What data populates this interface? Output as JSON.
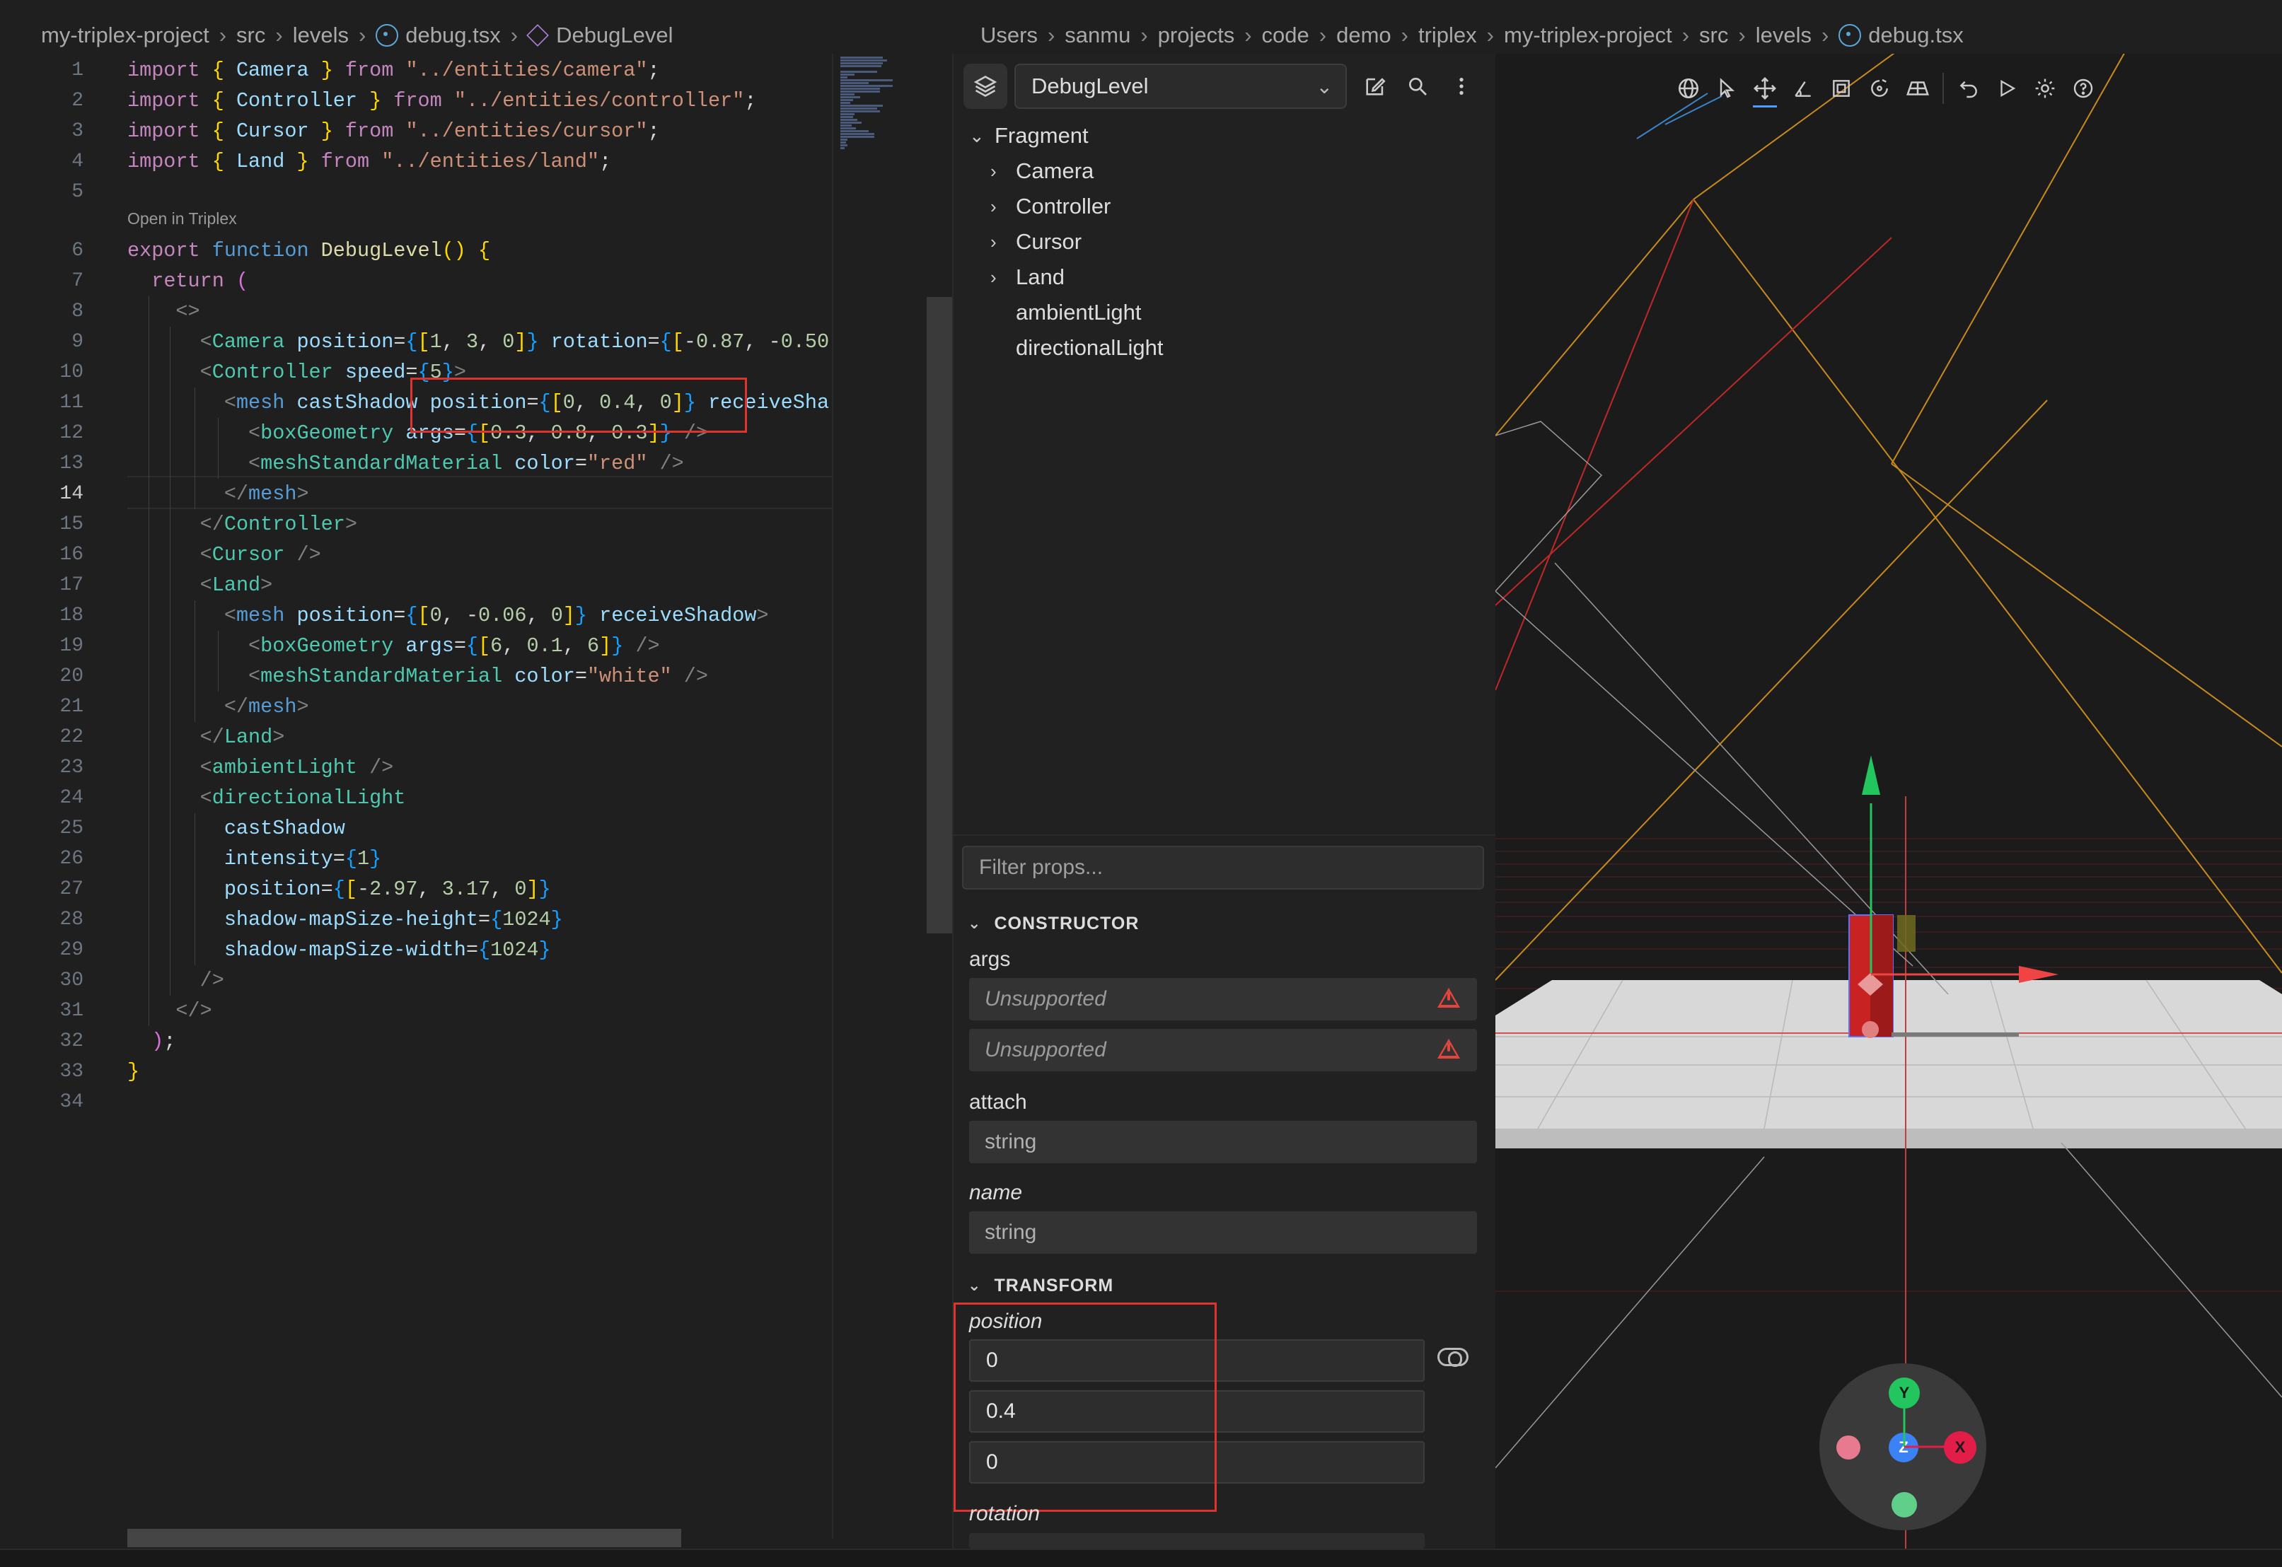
{
  "editor": {
    "breadcrumbs": [
      "my-triplex-project",
      "src",
      "levels",
      "debug.tsx",
      "DebugLevel"
    ],
    "codelens": "Open in Triplex",
    "current_line": 14,
    "lines": [
      {
        "n": "1",
        "tokens": [
          [
            "kw",
            "import"
          ],
          [
            "df",
            " "
          ],
          [
            "br1",
            "{"
          ],
          [
            "df",
            " "
          ],
          [
            "vr",
            "Camera"
          ],
          [
            "df",
            " "
          ],
          [
            "br1",
            "}"
          ],
          [
            "df",
            " "
          ],
          [
            "kw",
            "from"
          ],
          [
            "df",
            " "
          ],
          [
            "st",
            "\"../entities/camera\""
          ],
          [
            "df",
            ";"
          ]
        ]
      },
      {
        "n": "2",
        "tokens": [
          [
            "kw",
            "import"
          ],
          [
            "df",
            " "
          ],
          [
            "br1",
            "{"
          ],
          [
            "df",
            " "
          ],
          [
            "vr",
            "Controller"
          ],
          [
            "df",
            " "
          ],
          [
            "br1",
            "}"
          ],
          [
            "df",
            " "
          ],
          [
            "kw",
            "from"
          ],
          [
            "df",
            " "
          ],
          [
            "st",
            "\"../entities/controller\""
          ],
          [
            "df",
            ";"
          ]
        ]
      },
      {
        "n": "3",
        "tokens": [
          [
            "kw",
            "import"
          ],
          [
            "df",
            " "
          ],
          [
            "br1",
            "{"
          ],
          [
            "df",
            " "
          ],
          [
            "vr",
            "Cursor"
          ],
          [
            "df",
            " "
          ],
          [
            "br1",
            "}"
          ],
          [
            "df",
            " "
          ],
          [
            "kw",
            "from"
          ],
          [
            "df",
            " "
          ],
          [
            "st",
            "\"../entities/cursor\""
          ],
          [
            "df",
            ";"
          ]
        ]
      },
      {
        "n": "4",
        "tokens": [
          [
            "kw",
            "import"
          ],
          [
            "df",
            " "
          ],
          [
            "br1",
            "{"
          ],
          [
            "df",
            " "
          ],
          [
            "vr",
            "Land"
          ],
          [
            "df",
            " "
          ],
          [
            "br1",
            "}"
          ],
          [
            "df",
            " "
          ],
          [
            "kw",
            "from"
          ],
          [
            "df",
            " "
          ],
          [
            "st",
            "\"../entities/land\""
          ],
          [
            "df",
            ";"
          ]
        ]
      },
      {
        "n": "5",
        "tokens": []
      },
      {
        "n": "6",
        "tokens": [
          [
            "kw",
            "export"
          ],
          [
            "df",
            " "
          ],
          [
            "bl",
            "function"
          ],
          [
            "df",
            " "
          ],
          [
            "fn",
            "DebugLevel"
          ],
          [
            "br1",
            "()"
          ],
          [
            "df",
            " "
          ],
          [
            "br1",
            "{"
          ]
        ]
      },
      {
        "n": "7",
        "tokens": [
          [
            "df",
            "  "
          ],
          [
            "kw",
            "return"
          ],
          [
            "df",
            " "
          ],
          [
            "br2",
            "("
          ]
        ]
      },
      {
        "n": "8",
        "tokens": [
          [
            "df",
            "    "
          ],
          [
            "pn",
            "<>"
          ]
        ]
      },
      {
        "n": "9",
        "tokens": [
          [
            "df",
            "      "
          ],
          [
            "pn",
            "<"
          ],
          [
            "tg",
            "Camera"
          ],
          [
            "df",
            " "
          ],
          [
            "vr",
            "position"
          ],
          [
            "df",
            "="
          ],
          [
            "br3",
            "{"
          ],
          [
            "br1",
            "["
          ],
          [
            "nm",
            "1"
          ],
          [
            "df",
            ", "
          ],
          [
            "nm",
            "3"
          ],
          [
            "df",
            ", "
          ],
          [
            "nm",
            "0"
          ],
          [
            "br1",
            "]"
          ],
          [
            "br3",
            "}"
          ],
          [
            "df",
            " "
          ],
          [
            "vr",
            "rotation"
          ],
          [
            "df",
            "="
          ],
          [
            "br3",
            "{"
          ],
          [
            "br1",
            "["
          ],
          [
            "df",
            "-"
          ],
          [
            "nm",
            "0.87"
          ],
          [
            "df",
            ", -"
          ],
          [
            "nm",
            "0.50"
          ]
        ]
      },
      {
        "n": "10",
        "tokens": [
          [
            "df",
            "      "
          ],
          [
            "pn",
            "<"
          ],
          [
            "tg",
            "Controller"
          ],
          [
            "df",
            " "
          ],
          [
            "vr",
            "speed"
          ],
          [
            "df",
            "="
          ],
          [
            "br3",
            "{"
          ],
          [
            "nm",
            "5"
          ],
          [
            "br3",
            "}"
          ],
          [
            "pn",
            ">"
          ]
        ]
      },
      {
        "n": "11",
        "tokens": [
          [
            "df",
            "        "
          ],
          [
            "pn",
            "<"
          ],
          [
            "bl",
            "mesh"
          ],
          [
            "df",
            " "
          ],
          [
            "vr",
            "castShadow"
          ],
          [
            "df",
            " "
          ],
          [
            "vr",
            "position"
          ],
          [
            "df",
            "="
          ],
          [
            "br3",
            "{"
          ],
          [
            "br1",
            "["
          ],
          [
            "nm",
            "0"
          ],
          [
            "df",
            ", "
          ],
          [
            "nm",
            "0.4"
          ],
          [
            "df",
            ", "
          ],
          [
            "nm",
            "0"
          ],
          [
            "br1",
            "]"
          ],
          [
            "br3",
            "}"
          ],
          [
            "df",
            " "
          ],
          [
            "vr",
            "receiveSha"
          ]
        ]
      },
      {
        "n": "12",
        "tokens": [
          [
            "df",
            "          "
          ],
          [
            "pn",
            "<"
          ],
          [
            "tg",
            "boxGeometry"
          ],
          [
            "df",
            " "
          ],
          [
            "vr",
            "args"
          ],
          [
            "df",
            "="
          ],
          [
            "br3",
            "{"
          ],
          [
            "br1",
            "["
          ],
          [
            "nm",
            "0.3"
          ],
          [
            "df",
            ", "
          ],
          [
            "nm",
            "0.8"
          ],
          [
            "df",
            ", "
          ],
          [
            "nm",
            "0.3"
          ],
          [
            "br1",
            "]"
          ],
          [
            "br3",
            "}"
          ],
          [
            "df",
            " "
          ],
          [
            "pn",
            "/>"
          ]
        ]
      },
      {
        "n": "13",
        "tokens": [
          [
            "df",
            "          "
          ],
          [
            "pn",
            "<"
          ],
          [
            "tg",
            "meshStandardMaterial"
          ],
          [
            "df",
            " "
          ],
          [
            "vr",
            "color"
          ],
          [
            "df",
            "="
          ],
          [
            "st",
            "\"red\""
          ],
          [
            "df",
            " "
          ],
          [
            "pn",
            "/>"
          ]
        ]
      },
      {
        "n": "14",
        "tokens": [
          [
            "df",
            "        "
          ],
          [
            "pn",
            "</"
          ],
          [
            "bl",
            "mesh"
          ],
          [
            "pn",
            ">"
          ]
        ]
      },
      {
        "n": "15",
        "tokens": [
          [
            "df",
            "      "
          ],
          [
            "pn",
            "</"
          ],
          [
            "tg",
            "Controller"
          ],
          [
            "pn",
            ">"
          ]
        ]
      },
      {
        "n": "16",
        "tokens": [
          [
            "df",
            "      "
          ],
          [
            "pn",
            "<"
          ],
          [
            "tg",
            "Cursor"
          ],
          [
            "df",
            " "
          ],
          [
            "pn",
            "/>"
          ]
        ]
      },
      {
        "n": "17",
        "tokens": [
          [
            "df",
            "      "
          ],
          [
            "pn",
            "<"
          ],
          [
            "tg",
            "Land"
          ],
          [
            "pn",
            ">"
          ]
        ]
      },
      {
        "n": "18",
        "tokens": [
          [
            "df",
            "        "
          ],
          [
            "pn",
            "<"
          ],
          [
            "bl",
            "mesh"
          ],
          [
            "df",
            " "
          ],
          [
            "vr",
            "position"
          ],
          [
            "df",
            "="
          ],
          [
            "br3",
            "{"
          ],
          [
            "br1",
            "["
          ],
          [
            "nm",
            "0"
          ],
          [
            "df",
            ", -"
          ],
          [
            "nm",
            "0.06"
          ],
          [
            "df",
            ", "
          ],
          [
            "nm",
            "0"
          ],
          [
            "br1",
            "]"
          ],
          [
            "br3",
            "}"
          ],
          [
            "df",
            " "
          ],
          [
            "vr",
            "receiveShadow"
          ],
          [
            "pn",
            ">"
          ]
        ]
      },
      {
        "n": "19",
        "tokens": [
          [
            "df",
            "          "
          ],
          [
            "pn",
            "<"
          ],
          [
            "tg",
            "boxGeometry"
          ],
          [
            "df",
            " "
          ],
          [
            "vr",
            "args"
          ],
          [
            "df",
            "="
          ],
          [
            "br3",
            "{"
          ],
          [
            "br1",
            "["
          ],
          [
            "nm",
            "6"
          ],
          [
            "df",
            ", "
          ],
          [
            "nm",
            "0.1"
          ],
          [
            "df",
            ", "
          ],
          [
            "nm",
            "6"
          ],
          [
            "br1",
            "]"
          ],
          [
            "br3",
            "}"
          ],
          [
            "df",
            " "
          ],
          [
            "pn",
            "/>"
          ]
        ]
      },
      {
        "n": "20",
        "tokens": [
          [
            "df",
            "          "
          ],
          [
            "pn",
            "<"
          ],
          [
            "tg",
            "meshStandardMaterial"
          ],
          [
            "df",
            " "
          ],
          [
            "vr",
            "color"
          ],
          [
            "df",
            "="
          ],
          [
            "st",
            "\"white\""
          ],
          [
            "df",
            " "
          ],
          [
            "pn",
            "/>"
          ]
        ]
      },
      {
        "n": "21",
        "tokens": [
          [
            "df",
            "        "
          ],
          [
            "pn",
            "</"
          ],
          [
            "bl",
            "mesh"
          ],
          [
            "pn",
            ">"
          ]
        ]
      },
      {
        "n": "22",
        "tokens": [
          [
            "df",
            "      "
          ],
          [
            "pn",
            "</"
          ],
          [
            "tg",
            "Land"
          ],
          [
            "pn",
            ">"
          ]
        ]
      },
      {
        "n": "23",
        "tokens": [
          [
            "df",
            "      "
          ],
          [
            "pn",
            "<"
          ],
          [
            "tg",
            "ambientLight"
          ],
          [
            "df",
            " "
          ],
          [
            "pn",
            "/>"
          ]
        ]
      },
      {
        "n": "24",
        "tokens": [
          [
            "df",
            "      "
          ],
          [
            "pn",
            "<"
          ],
          [
            "tg",
            "directionalLight"
          ]
        ]
      },
      {
        "n": "25",
        "tokens": [
          [
            "df",
            "        "
          ],
          [
            "vr",
            "castShadow"
          ]
        ]
      },
      {
        "n": "26",
        "tokens": [
          [
            "df",
            "        "
          ],
          [
            "vr",
            "intensity"
          ],
          [
            "df",
            "="
          ],
          [
            "br3",
            "{"
          ],
          [
            "nm",
            "1"
          ],
          [
            "br3",
            "}"
          ]
        ]
      },
      {
        "n": "27",
        "tokens": [
          [
            "df",
            "        "
          ],
          [
            "vr",
            "position"
          ],
          [
            "df",
            "="
          ],
          [
            "br3",
            "{"
          ],
          [
            "br1",
            "["
          ],
          [
            "df",
            "-"
          ],
          [
            "nm",
            "2.97"
          ],
          [
            "df",
            ", "
          ],
          [
            "nm",
            "3.17"
          ],
          [
            "df",
            ", "
          ],
          [
            "nm",
            "0"
          ],
          [
            "br1",
            "]"
          ],
          [
            "br3",
            "}"
          ]
        ]
      },
      {
        "n": "28",
        "tokens": [
          [
            "df",
            "        "
          ],
          [
            "vr",
            "shadow-mapSize-height"
          ],
          [
            "df",
            "="
          ],
          [
            "br3",
            "{"
          ],
          [
            "nm",
            "1024"
          ],
          [
            "br3",
            "}"
          ]
        ]
      },
      {
        "n": "29",
        "tokens": [
          [
            "df",
            "        "
          ],
          [
            "vr",
            "shadow-mapSize-width"
          ],
          [
            "df",
            "="
          ],
          [
            "br3",
            "{"
          ],
          [
            "nm",
            "1024"
          ],
          [
            "br3",
            "}"
          ]
        ]
      },
      {
        "n": "30",
        "tokens": [
          [
            "df",
            "      "
          ],
          [
            "pn",
            "/>"
          ]
        ]
      },
      {
        "n": "31",
        "tokens": [
          [
            "df",
            "    "
          ],
          [
            "pn",
            "</>"
          ]
        ]
      },
      {
        "n": "32",
        "tokens": [
          [
            "df",
            "  "
          ],
          [
            "br2",
            ")"
          ],
          [
            "df",
            ";"
          ]
        ]
      },
      {
        "n": "33",
        "tokens": [
          [
            "br1",
            "}"
          ]
        ]
      },
      {
        "n": "34",
        "tokens": []
      }
    ]
  },
  "path_breadcrumbs": [
    "Users",
    "sanmu",
    "projects",
    "code",
    "demo",
    "triplex",
    "my-triplex-project",
    "src",
    "levels",
    "debug.tsx"
  ],
  "scene": {
    "selected_component": "DebugLevel",
    "tree": [
      {
        "label": "Fragment",
        "expanded": true,
        "depth": 0
      },
      {
        "label": "Camera",
        "expanded": false,
        "depth": 1
      },
      {
        "label": "Controller",
        "expanded": false,
        "depth": 1
      },
      {
        "label": "Cursor",
        "expanded": false,
        "depth": 1
      },
      {
        "label": "Land",
        "expanded": false,
        "depth": 1
      },
      {
        "label": "ambientLight",
        "leaf": true,
        "depth": 1
      },
      {
        "label": "directionalLight",
        "leaf": true,
        "depth": 1
      }
    ]
  },
  "props": {
    "filter_placeholder": "Filter props...",
    "constructor_title": "CONSTRUCTOR",
    "args_label": "args",
    "args_values": [
      "Unsupported",
      "Unsupported"
    ],
    "attach_label": "attach",
    "attach_value": "string",
    "name_label": "name",
    "name_value": "string",
    "transform_title": "TRANSFORM",
    "position_label": "position",
    "position_values": [
      "0",
      "0.4",
      "0"
    ],
    "rotation_label": "rotation"
  },
  "gizmo": {
    "y": "Y",
    "z": "Z",
    "x": "X"
  },
  "colors": {
    "accent": "#4a9eff",
    "highlight_box": "#e0332e",
    "warning": "#e2453c"
  }
}
